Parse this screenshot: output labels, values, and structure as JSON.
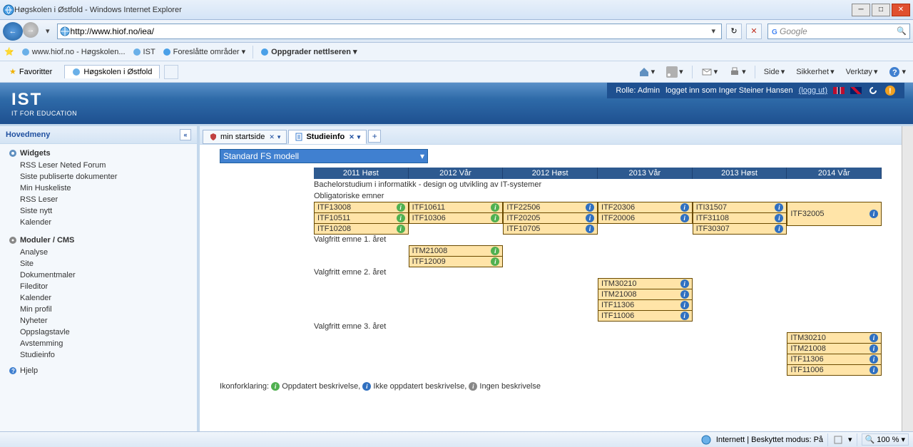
{
  "window": {
    "title": "Høgskolen i Østfold - Windows Internet Explorer"
  },
  "nav": {
    "url": "http://www.hiof.no/iea/",
    "search_placeholder": "Google"
  },
  "links": {
    "items": [
      {
        "label": "www.hiof.no - Høgskolen..."
      },
      {
        "label": "IST"
      },
      {
        "label": "Foreslåtte områder"
      },
      {
        "label": "Oppgrader nettlseren"
      }
    ]
  },
  "favbar": {
    "fav_label": "Favoritter",
    "tab_label": "Høgskolen i Østfold",
    "tools": {
      "side": "Side",
      "sikkerhet": "Sikkerhet",
      "verktoy": "Verktøy"
    }
  },
  "app": {
    "logo_top": "IST",
    "logo_sub": "IT FOR EDUCATION",
    "role": "Rolle: Admin",
    "logged": "logget inn som Inger Steiner Hansen",
    "logout": "(logg ut)"
  },
  "sidebar": {
    "heading": "Hovedmeny",
    "widgets_h": "Widgets",
    "widgets": [
      "RSS Leser Neted Forum",
      "Siste publiserte dokumenter",
      "Min Huskeliste",
      "RSS Leser",
      "Siste nytt",
      "Kalender"
    ],
    "cms_h": "Moduler / CMS",
    "cms": [
      "Analyse",
      "Site",
      "Dokumentmaler",
      "Fileditor",
      "Kalender",
      "Min profil",
      "Nyheter",
      "Oppslagstavle",
      "Avstemming",
      "Studieinfo"
    ],
    "help": "Hjelp"
  },
  "tabs": {
    "start": "min startside",
    "study": "Studieinfo"
  },
  "content": {
    "model": "Standard FS modell",
    "semesters": [
      "2011 Høst",
      "2012 Vår",
      "2012 Høst",
      "2013 Vår",
      "2013 Høst",
      "2014 Vår"
    ],
    "program": "Bachelorstudium i informatikk - design og utvikling av IT-systemer",
    "section1": "Obligatoriske emner",
    "row1": {
      "c11": "ITF13008",
      "c12": "ITF10611",
      "c13": "ITF22506",
      "c14": "ITF20306",
      "c15": "ITI31507",
      "c16": "ITF32005"
    },
    "row2": {
      "c21": "ITF10511",
      "c22": "ITF10306",
      "c23": "ITF20205",
      "c24": "ITF20006",
      "c25": "ITF31108"
    },
    "row3": {
      "c31": "ITF10208",
      "c33": "ITF10705",
      "c35": "ITF30307"
    },
    "section2": "Valgfritt emne 1. året",
    "v1": [
      "ITM21008",
      "ITF12009"
    ],
    "section3": "Valgfritt emne 2. året",
    "v2": [
      "ITM30210",
      "ITM21008",
      "ITF11306",
      "ITF11006"
    ],
    "section4": "Valgfritt emne 3. året",
    "v3": [
      "ITM30210",
      "ITM21008",
      "ITF11306",
      "ITF11006"
    ],
    "legend_pre": "Ikonforklaring:",
    "legend1": "Oppdatert beskrivelse,",
    "legend2": "Ikke oppdatert beskrivelse,",
    "legend3": "Ingen beskrivelse"
  },
  "status": {
    "zone": "Internett | Beskyttet modus: På",
    "zoom": "100 %"
  }
}
